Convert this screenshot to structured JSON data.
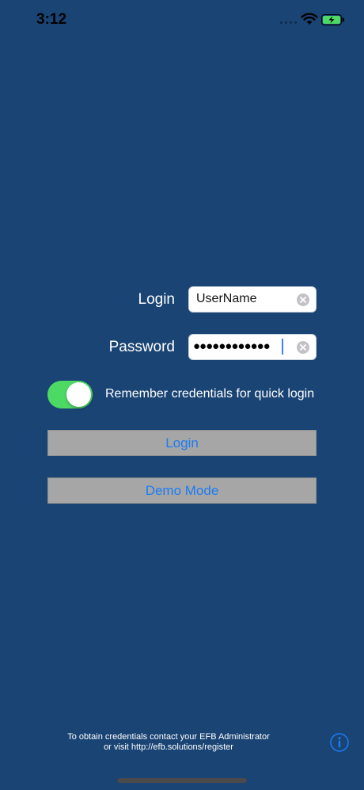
{
  "status_bar": {
    "time": "3:12"
  },
  "login_form": {
    "login_label": "Login",
    "username_value": "UserName",
    "password_label": "Password",
    "password_masked": "●●●●●●●●●●●●"
  },
  "remember": {
    "label": "Remember credentials for quick login",
    "enabled": true
  },
  "buttons": {
    "login_label": "Login",
    "demo_label": "Demo Mode"
  },
  "footer": {
    "line1": "To obtain credentials contact your EFB Administrator",
    "line2": "or visit http://efb.solutions/register"
  },
  "icons": {
    "wifi": "wifi-icon",
    "battery": "battery-charging-icon",
    "clear": "clear-icon",
    "info": "info-icon"
  },
  "colors": {
    "background": "#1a4474",
    "accent": "#1c7cf4",
    "toggle_on": "#4cd964",
    "button_gray": "#a6a6a6"
  }
}
